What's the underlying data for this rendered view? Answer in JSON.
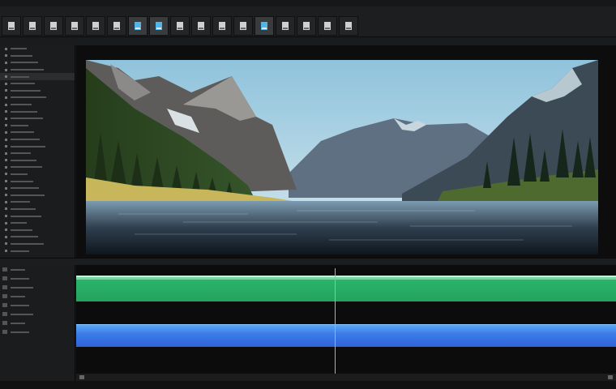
{
  "toolbar": {
    "tools": [
      {
        "icon": "pen-icon",
        "active": false
      },
      {
        "icon": "page-icon",
        "active": false
      },
      {
        "icon": "number-six-icon",
        "active": false
      },
      {
        "icon": "clip-icon",
        "active": false
      },
      {
        "icon": "page-icon",
        "active": false
      },
      {
        "icon": "document-icon",
        "active": false
      },
      {
        "icon": "thumbnail-icon",
        "active": true
      },
      {
        "icon": "window-icon",
        "active": true
      },
      {
        "icon": "folder-icon",
        "active": false
      },
      {
        "icon": "clip-icon",
        "active": false
      },
      {
        "icon": "page-icon",
        "active": false
      },
      {
        "icon": "image-icon",
        "active": false
      },
      {
        "icon": "monitor-icon",
        "active": true
      },
      {
        "icon": "media-icon",
        "active": false
      },
      {
        "icon": "pencil-icon",
        "active": false
      },
      {
        "icon": "crop-icon",
        "active": false
      },
      {
        "icon": "audio-icon",
        "active": false
      }
    ]
  },
  "viewer": {
    "image": "mountain-lake-landscape"
  },
  "colors": {
    "video_track": "#2bb36b",
    "audio_track": "#3b7ce8",
    "playhead": "#5ec8ff",
    "background": "#161718"
  }
}
